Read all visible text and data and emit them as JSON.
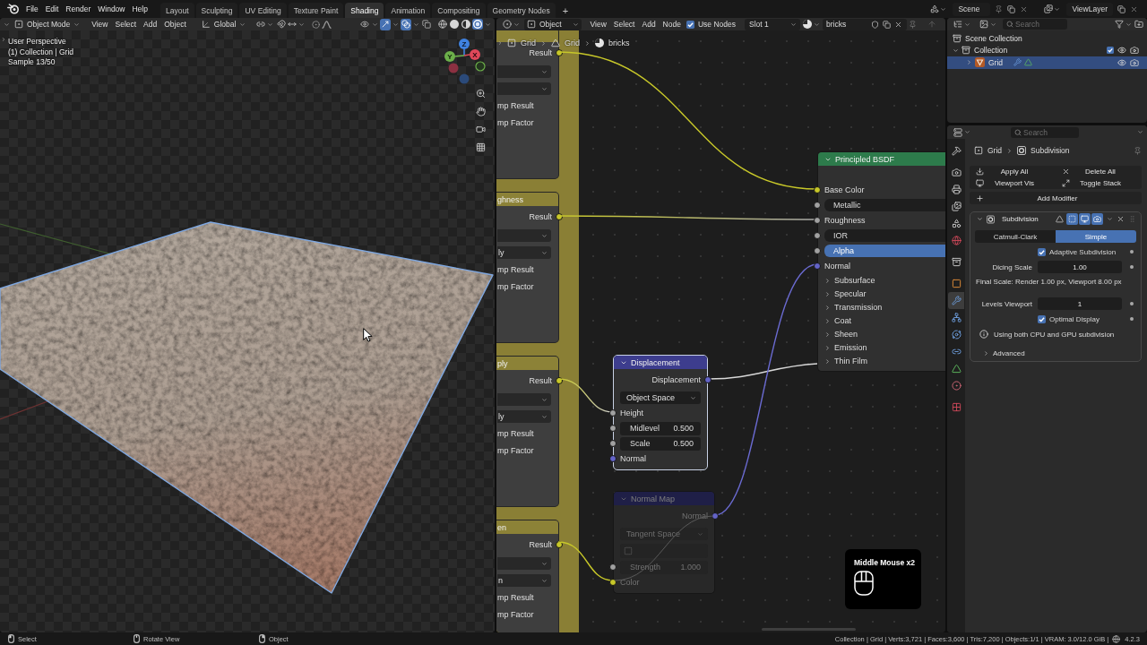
{
  "topbar": {
    "menus": [
      "File",
      "Edit",
      "Render",
      "Window",
      "Help"
    ],
    "workspaces": [
      {
        "label": "Layout",
        "selected": false
      },
      {
        "label": "Sculpting",
        "selected": false
      },
      {
        "label": "UV Editing",
        "selected": false
      },
      {
        "label": "Texture Paint",
        "selected": false
      },
      {
        "label": "Shading",
        "selected": true
      },
      {
        "label": "Animation",
        "selected": false
      },
      {
        "label": "Compositing",
        "selected": false
      },
      {
        "label": "Geometry Nodes",
        "selected": false
      }
    ],
    "add_workspace": "+",
    "scene": "Scene",
    "view_layer": "ViewLayer"
  },
  "viewport": {
    "header": {
      "mode": "Object Mode",
      "menus": [
        "View",
        "Select",
        "Add",
        "Object"
      ],
      "orientation": "Global",
      "toggles": [
        {
          "kind": "selectability",
          "on": false
        },
        {
          "kind": "gizmos",
          "on": true
        },
        {
          "kind": "overlays",
          "on": true
        },
        {
          "kind": "xray",
          "on": false
        }
      ],
      "shading": [
        {
          "kind": "wireframe",
          "selected": false
        },
        {
          "kind": "solid",
          "selected": false
        },
        {
          "kind": "material",
          "selected": false
        },
        {
          "kind": "rendered",
          "selected": true
        }
      ]
    },
    "info": [
      "User Perspective",
      "(1) Collection | Grid",
      "Sample 13/50"
    ],
    "gizmo_axes": [
      "Z",
      "Y",
      "X"
    ]
  },
  "node_editor": {
    "header": {
      "editor": "Object",
      "menus": [
        "View",
        "Select",
        "Add",
        "Node"
      ],
      "use_nodes": {
        "label": "Use Nodes",
        "checked": true
      },
      "slot": "Slot 1",
      "material": "bricks"
    },
    "breadcrumbs": [
      {
        "kind": "object",
        "label": "Grid"
      },
      {
        "kind": "mesh",
        "label": "Grid"
      },
      {
        "kind": "material",
        "label": "bricks"
      }
    ],
    "frame_nodes": [
      {
        "rows": [
          {
            "kind": "output",
            "label": "Result",
            "color": "#c7c729"
          },
          {
            "kind": "dropdown"
          },
          {
            "kind": "dropdown"
          },
          {
            "kind": "input",
            "label": "mp Result"
          },
          {
            "kind": "input",
            "label": "mp Factor"
          }
        ]
      },
      {
        "title": "ghness",
        "rows": [
          {
            "kind": "output",
            "label": "Result",
            "color": "#c7c729"
          },
          {
            "kind": "dropdown"
          },
          {
            "kind": "dropdown",
            "value": "ly"
          },
          {
            "kind": "input",
            "label": "mp Result"
          },
          {
            "kind": "input",
            "label": "mp Factor"
          }
        ]
      },
      {
        "title": "ply",
        "rows": [
          {
            "kind": "output",
            "label": "Result",
            "color": "#c7c729"
          },
          {
            "kind": "dropdown"
          },
          {
            "kind": "dropdown",
            "value": "ly"
          },
          {
            "kind": "input",
            "label": "mp Result"
          },
          {
            "kind": "input",
            "label": "mp Factor"
          }
        ]
      },
      {
        "title": "en",
        "rows": [
          {
            "kind": "output",
            "label": "Result",
            "color": "#c7c729"
          },
          {
            "kind": "dropdown"
          },
          {
            "kind": "dropdown",
            "value": "n"
          },
          {
            "kind": "input",
            "label": "mp Result"
          },
          {
            "kind": "input",
            "label": "mp Factor"
          }
        ]
      }
    ],
    "nodes": [
      {
        "kind": "shader",
        "title": "Principled BSDF",
        "selected": false,
        "muted": false,
        "inputs": [
          {
            "kind": "socket",
            "label": "Base Color",
            "color": "#c7c729"
          },
          {
            "kind": "field",
            "label": "Metallic",
            "color": "#a1a1a1",
            "highlighted": false
          },
          {
            "kind": "socket",
            "label": "Roughness",
            "color": "#a1a1a1"
          },
          {
            "kind": "field",
            "label": "IOR",
            "color": "#a1a1a1",
            "highlighted": false
          },
          {
            "kind": "field",
            "label": "Alpha",
            "color": "#a1a1a1",
            "highlighted": true
          },
          {
            "kind": "socket",
            "label": "Normal",
            "color": "#6363c7"
          },
          {
            "kind": "panel",
            "label": "Subsurface",
            "expanded": false
          },
          {
            "kind": "panel",
            "label": "Specular",
            "expanded": false
          },
          {
            "kind": "panel",
            "label": "Transmission",
            "expanded": false
          },
          {
            "kind": "panel",
            "label": "Coat",
            "expanded": false
          },
          {
            "kind": "panel",
            "label": "Sheen",
            "expanded": false
          },
          {
            "kind": "panel",
            "label": "Emission",
            "expanded": false
          },
          {
            "kind": "panel",
            "label": "Thin Film",
            "expanded": false
          }
        ]
      },
      {
        "kind": "vector",
        "title": "Displacement",
        "selected": true,
        "muted": false,
        "outputs": [
          {
            "label": "Displacement",
            "color": "#6363c7"
          }
        ],
        "inputs": [
          {
            "kind": "dropdown",
            "value": "Object Space"
          },
          {
            "kind": "socket",
            "label": "Height",
            "color": "#a1a1a1"
          },
          {
            "kind": "number",
            "label": "Midlevel",
            "value": "0.500",
            "color": "#a1a1a1"
          },
          {
            "kind": "number",
            "label": "Scale",
            "value": "0.500",
            "color": "#a1a1a1"
          },
          {
            "kind": "socket",
            "label": "Normal",
            "color": "#6363c7"
          }
        ]
      },
      {
        "kind": "vector",
        "title": "Normal Map",
        "selected": false,
        "muted": true,
        "outputs": [
          {
            "label": "Normal",
            "color": "#6363c7"
          }
        ],
        "inputs": [
          {
            "kind": "dropdown",
            "value": "Tangent Space"
          },
          {
            "kind": "uv_map"
          },
          {
            "kind": "number",
            "label": "Strength",
            "value": "1.000",
            "color": "#a1a1a1"
          },
          {
            "kind": "socket",
            "label": "Color",
            "color": "#c7c729"
          }
        ]
      }
    ],
    "hint": {
      "text": "Middle Mouse x2"
    }
  },
  "outliner": {
    "search": {
      "placeholder": "Search"
    },
    "tree": [
      {
        "kind": "scene_collection",
        "label": "Scene Collection",
        "selected": false,
        "children": [
          {
            "kind": "collection",
            "label": "Collection",
            "selected": false,
            "expanded": true,
            "checked": true,
            "children": [
              {
                "kind": "mesh_object",
                "label": "Grid",
                "selected": true,
                "expanded": false
              }
            ]
          }
        ]
      }
    ]
  },
  "properties": {
    "search": {
      "placeholder": "Search"
    },
    "tabs": [
      {
        "kind": "tool",
        "selected": false
      },
      {
        "kind": "render",
        "selected": false
      },
      {
        "kind": "output",
        "selected": false
      },
      {
        "kind": "view_layer",
        "selected": false
      },
      {
        "kind": "scene",
        "selected": false
      },
      {
        "kind": "world",
        "selected": false
      },
      {
        "kind": "collection",
        "selected": false
      },
      {
        "kind": "object",
        "selected": false
      },
      {
        "kind": "modifiers",
        "selected": true
      },
      {
        "kind": "particles",
        "selected": false
      },
      {
        "kind": "physics",
        "selected": false
      },
      {
        "kind": "constraints",
        "selected": false
      },
      {
        "kind": "data",
        "selected": false
      },
      {
        "kind": "material",
        "selected": false
      },
      {
        "kind": "texture",
        "selected": false
      }
    ],
    "breadcrumbs": [
      {
        "kind": "object",
        "label": "Grid"
      },
      {
        "kind": "modifier",
        "label": "Subdivision"
      }
    ],
    "actions": [
      {
        "kind": "apply",
        "label": "Apply All"
      },
      {
        "kind": "delete",
        "label": "Delete All"
      },
      {
        "kind": "visibility",
        "label": "Viewport Vis"
      },
      {
        "kind": "toggle_stack",
        "label": "Toggle Stack"
      }
    ],
    "add_modifier": "Add Modifier",
    "modifier": {
      "name": "Subdivision",
      "expanded": true,
      "toggles": [
        {
          "kind": "on_cage",
          "on": false
        },
        {
          "kind": "edit_mode",
          "on": true
        },
        {
          "kind": "viewport",
          "on": true
        },
        {
          "kind": "render",
          "on": true
        }
      ],
      "types": [
        {
          "label": "Catmull-Clark",
          "selected": false
        },
        {
          "label": "Simple",
          "selected": true
        }
      ],
      "settings": [
        {
          "kind": "checkbox",
          "label": "Adaptive Subdivision",
          "checked": true
        },
        {
          "kind": "number",
          "label": "Dicing Scale",
          "value": "1.00"
        },
        {
          "kind": "text",
          "label": "Final Scale: Render 1.00 px, Viewport 8.00 px"
        },
        {
          "kind": "number",
          "label": "Levels Viewport",
          "value": "1"
        },
        {
          "kind": "checkbox",
          "label": "Optimal Display",
          "checked": true
        },
        {
          "kind": "info",
          "label": "Using both CPU and GPU subdivision"
        }
      ],
      "subpanels": [
        {
          "label": "Advanced",
          "expanded": false
        }
      ]
    }
  },
  "status_bar": {
    "hints": [
      {
        "kind": "left_click",
        "label": "Select"
      },
      {
        "kind": "middle_click",
        "label": "Rotate View"
      },
      {
        "kind": "right_click",
        "label": "Object"
      }
    ],
    "stats": "Collection | Grid | Verts:3,721 | Faces:3,600 | Tris:7,200 | Objects:1/1 | VRAM: 3.0/12.0 GiB |",
    "version": "4.2.3"
  }
}
